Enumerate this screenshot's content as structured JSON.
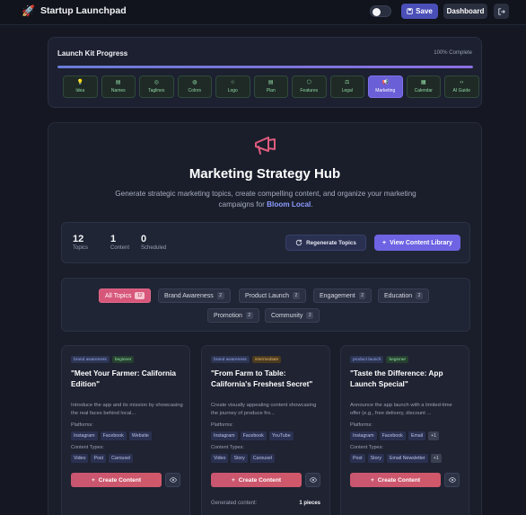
{
  "app": {
    "brand_icon": "rocket-icon",
    "title": "Startup Launchpad",
    "save_label": "Save",
    "dashboard_label": "Dashboard",
    "exit_icon": "sign-out-icon",
    "theme_toggle": "light"
  },
  "progress": {
    "title": "Launch Kit Progress",
    "complete_label": "100% Complete",
    "fill_fraction": 1.0,
    "steps": [
      {
        "label": "Idea",
        "icon": "💡",
        "active": false
      },
      {
        "label": "Names",
        "icon": "▤",
        "active": false
      },
      {
        "label": "Taglines",
        "icon": "◎",
        "active": false
      },
      {
        "label": "Colors",
        "icon": "◍",
        "active": false
      },
      {
        "label": "Logo",
        "icon": "☆",
        "active": false
      },
      {
        "label": "Plan",
        "icon": "▤",
        "active": false
      },
      {
        "label": "Features",
        "icon": "⬡",
        "active": false
      },
      {
        "label": "Legal",
        "icon": "⚖",
        "active": false
      },
      {
        "label": "Marketing",
        "icon": "📢",
        "active": true
      },
      {
        "label": "Calendar",
        "icon": "▦",
        "active": false
      },
      {
        "label": "AI Guide",
        "icon": "‹›",
        "active": false
      }
    ]
  },
  "hub": {
    "icon": "megaphone-icon",
    "title": "Marketing Strategy Hub",
    "desc_before": "Generate strategic marketing topics, create compelling content, and organize your marketing campaigns for ",
    "desc_highlight": "Bloom Local",
    "desc_after": ".",
    "stats": [
      {
        "value": "12",
        "label": "Topics"
      },
      {
        "value": "1",
        "label": "Content"
      },
      {
        "value": "0",
        "label": "Scheduled"
      }
    ],
    "regenerate_label": "Regenerate Topics",
    "library_label": "View Content Library"
  },
  "filters": [
    {
      "label": "All Topics",
      "count": "12",
      "active": true
    },
    {
      "label": "Brand Awareness",
      "count": "2",
      "active": false
    },
    {
      "label": "Product Launch",
      "count": "2",
      "active": false
    },
    {
      "label": "Engagement",
      "count": "2",
      "active": false
    },
    {
      "label": "Education",
      "count": "2",
      "active": false
    },
    {
      "label": "Promotion",
      "count": "2",
      "active": false
    },
    {
      "label": "Community",
      "count": "2",
      "active": false
    }
  ],
  "cards": [
    {
      "category": "brand awareness",
      "level": "beginner",
      "title": "\"Meet Your Farmer: California Edition\"",
      "desc": "Introduce the app and its mission by showcasing the real faces behind local...",
      "platforms_label": "Platforms:",
      "platforms": [
        "Instagram",
        "Facebook",
        "Website"
      ],
      "content_types_label": "Content Types:",
      "content_types": [
        "Video",
        "Post",
        "Carousel"
      ],
      "create_label": "Create Content"
    },
    {
      "category": "brand awareness",
      "level": "intermediate",
      "title": "\"From Farm to Table: California's Freshest Secret\"",
      "desc": "Create visually appealing content showcasing the journey of produce fro...",
      "platforms_label": "Platforms:",
      "platforms": [
        "Instagram",
        "Facebook",
        "YouTube"
      ],
      "content_types_label": "Content Types:",
      "content_types": [
        "Video",
        "Story",
        "Carousel"
      ],
      "create_label": "Create Content",
      "generated_label": "Generated content:",
      "generated_value": "1 pieces"
    },
    {
      "category": "product launch",
      "level": "beginner",
      "title": "\"Taste the Difference: App Launch Special\"",
      "desc": "Announce the app launch with a limited-time offer (e.g., free delivery, discount ...",
      "platforms_label": "Platforms:",
      "platforms": [
        "Instagram",
        "Facebook",
        "Email"
      ],
      "platforms_more": "+1",
      "content_types_label": "Content Types:",
      "content_types": [
        "Post",
        "Story",
        "Email Newsletter"
      ],
      "content_types_more": "+1",
      "create_label": "Create Content"
    }
  ]
}
